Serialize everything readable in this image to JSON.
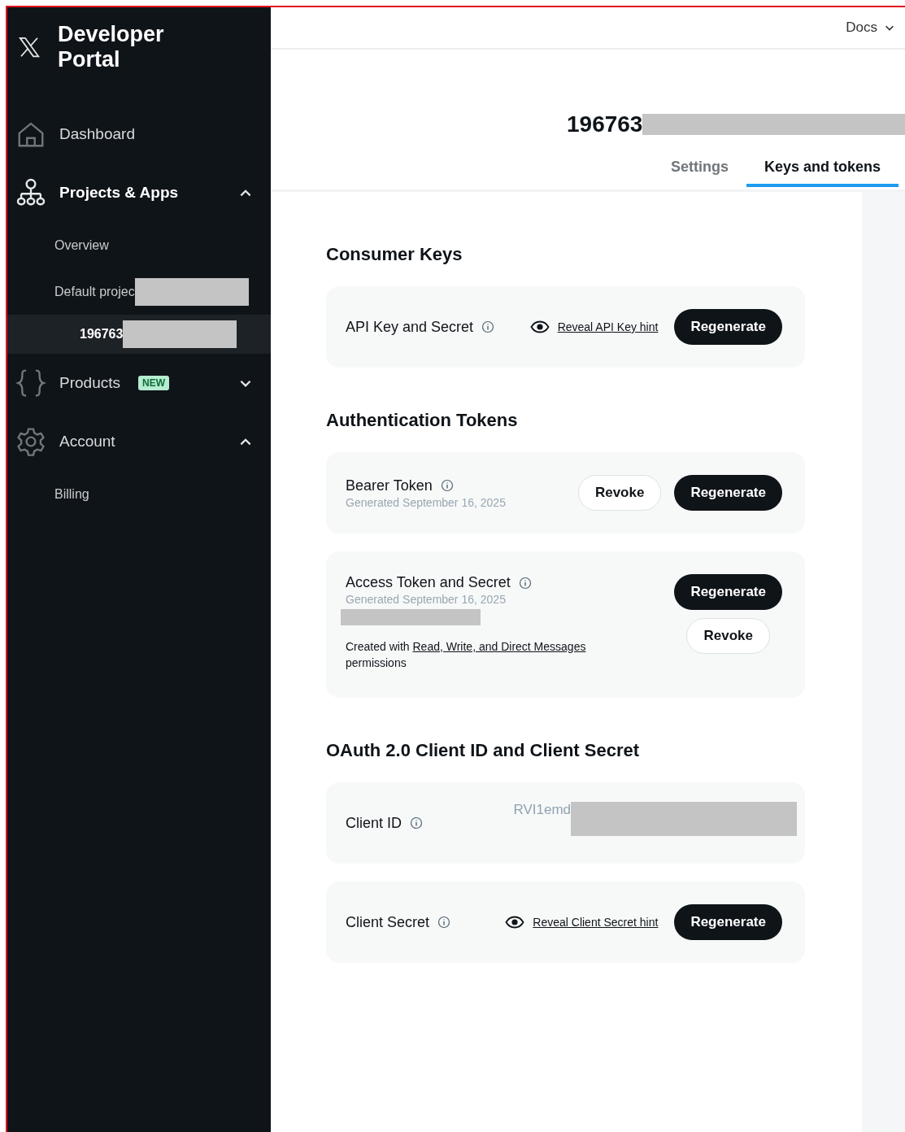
{
  "sidebar": {
    "logo_title": "Developer Portal",
    "items": [
      {
        "label": "Dashboard",
        "selected": false
      },
      {
        "label": "Projects & Apps",
        "expanded": true,
        "selected": false,
        "children": [
          {
            "label": "Overview",
            "selected": false,
            "redacted": false
          },
          {
            "label": "Default projec",
            "selected": false,
            "redacted": true
          },
          {
            "label": "196763",
            "selected": true,
            "redacted": true
          }
        ]
      },
      {
        "label": "Products",
        "badge": "NEW",
        "expanded": false,
        "selected": false
      },
      {
        "label": "Account",
        "expanded": true,
        "selected": false,
        "children": [
          {
            "label": "Billing",
            "selected": false,
            "redacted": false
          }
        ]
      }
    ]
  },
  "topbar": {
    "docs": "Docs"
  },
  "app": {
    "title": "196763",
    "tabs": [
      {
        "label": "Settings",
        "selected": false
      },
      {
        "label": "Keys and tokens",
        "selected": true
      }
    ]
  },
  "sections": [
    {
      "title": "Consumer Keys",
      "rows": [
        {
          "kind": "inline",
          "label": "API Key and Secret",
          "reveal_link": "Reveal API Key hint",
          "buttons": [
            {
              "label": "Regenerate",
              "kind": "primary"
            }
          ]
        }
      ]
    },
    {
      "title": "Authentication Tokens",
      "rows": [
        {
          "kind": "inline",
          "label": "Bearer Token",
          "generated": "Generated September 16, 2025",
          "buttons": [
            {
              "label": "Revoke",
              "kind": "secondary"
            },
            {
              "label": "Regenerate",
              "kind": "primary"
            }
          ]
        },
        {
          "kind": "stacked",
          "label": "Access Token and Secret",
          "generated": "Generated September 16, 2025",
          "note_before": "Created with",
          "note_link": "Read, Write, and Direct Messages",
          "note_after": "permissions",
          "buttons": [
            {
              "label": "Regenerate",
              "kind": "primary"
            },
            {
              "label": "Revoke",
              "kind": "secondary"
            }
          ]
        }
      ]
    },
    {
      "title": "OAuth 2.0 Client ID and Client Secret",
      "rows": [
        {
          "kind": "value",
          "label": "Client ID",
          "value": "RVI1emd"
        },
        {
          "kind": "inline",
          "label": "Client Secret",
          "reveal_link": "Reveal Client Secret hint",
          "buttons": [
            {
              "label": "Regenerate",
              "kind": "primary"
            }
          ]
        }
      ]
    }
  ]
}
